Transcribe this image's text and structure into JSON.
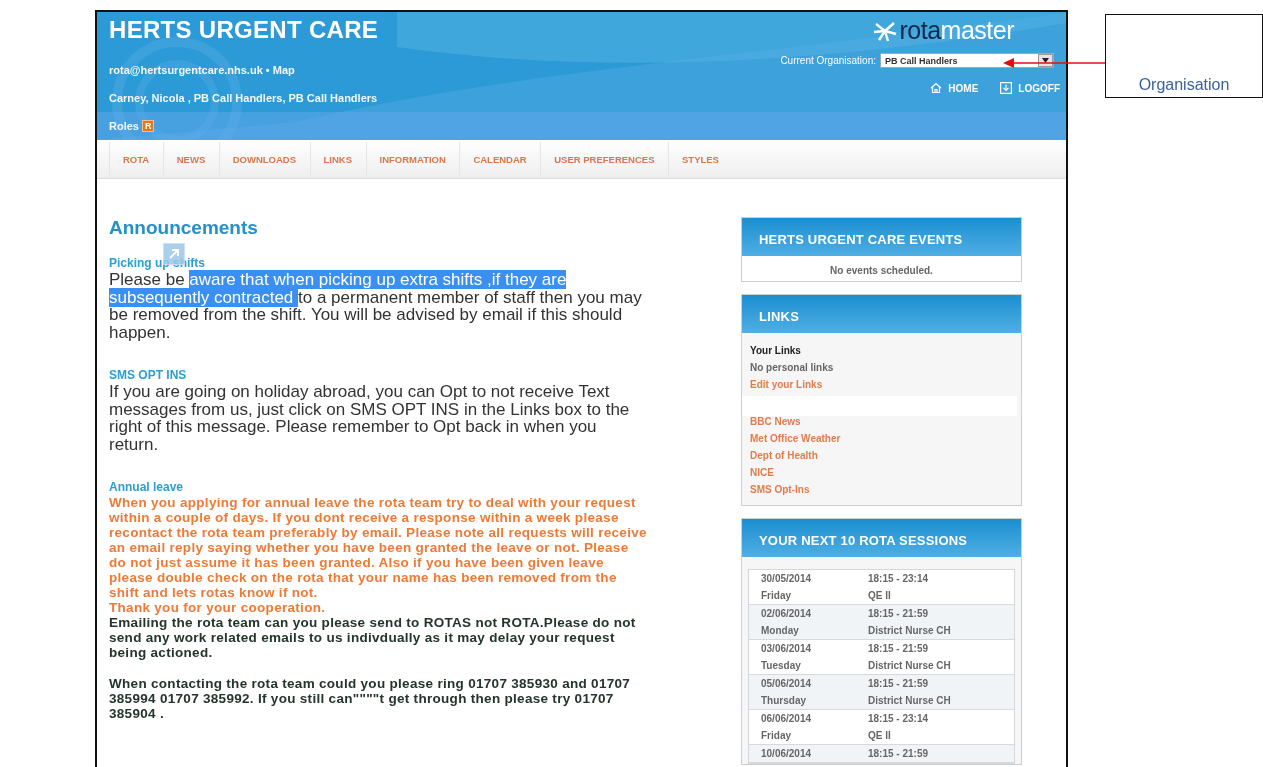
{
  "header": {
    "title": "HERTS URGENT CARE",
    "contact_line": "rota@hertsurgentcare.nhs.uk • Map",
    "user_line": "Carney, Nicola , PB Call Handlers, PB Call Handlers",
    "roles_label": "Roles",
    "roles_badge": "R",
    "logo": [
      {
        "text": "rota",
        "kind": "dark"
      },
      {
        "text": "master",
        "kind": "light"
      }
    ],
    "organisation_label": "Current Organisation:",
    "organisation_value": "PB Call Handlers",
    "actions": [
      {
        "label": "HOME",
        "kind": "home"
      },
      {
        "label": "LOGOFF",
        "kind": "logoff"
      }
    ]
  },
  "nav": [
    "ROTA",
    "NEWS",
    "DOWNLOADS",
    "LINKS",
    "INFORMATION",
    "CALENDAR",
    "USER PREFERENCES",
    "STYLES"
  ],
  "announcements": {
    "title": "Announcements",
    "items": [
      {
        "heading": "Picking up shifts",
        "covered": true,
        "paragraphs": [
          {
            "kind": "plain",
            "segments": [
              {
                "text": "Please be ",
                "highlighted": false
              },
              {
                "text": "aware that when picking up extra shifts ,if they are subsequently contracted ",
                "highlighted": true
              },
              {
                "text": "to a permanent member of staff then you may  be removed  from the shift. You will be advised by email if this should happen.",
                "highlighted": false
              }
            ]
          }
        ]
      },
      {
        "heading": "SMS OPT INS",
        "covered": false,
        "paragraphs": [
          {
            "kind": "plain",
            "segments": [
              {
                "text": "If you are going on holiday abroad, you can Opt to not receive Text messages from us, just click on  SMS OPT INS in the Links box to the right of this message. Please remember to Opt back in when you return.",
                "highlighted": false
              }
            ]
          }
        ]
      },
      {
        "heading": "Annual leave",
        "covered": false,
        "paragraphs": [
          {
            "kind": "orange",
            "segments": [
              {
                "text": "When you  applying for annual leave the rota team try to deal with your request within a couple of days. If you dont receive a response within a week please recontact the rota team preferably by email. Please note all requests will receive an email reply saying whether you have been granted the leave or not.  Please do not just assume it has been granted. Also if you have been given leave please double check on the rota that your name has been removed from the shift and lets rotas know  if not.",
                "highlighted": false
              }
            ]
          },
          {
            "kind": "orange",
            "segments": [
              {
                "text": "Thank you for your cooperation.",
                "highlighted": false
              }
            ]
          },
          {
            "kind": "dark",
            "segments": [
              {
                "text": "Emailing the rota team can you please send to ROTAS not ROTA.Please do not send any work related emails to us indivdually as it may delay your request being actioned.",
                "highlighted": false
              }
            ]
          },
          {
            "kind": "dark-spaced",
            "segments": [
              {
                "text": "When contacting the rota team could you please ring 01707 385930 and 01707  385994 01707 385992. If you still can\"\"\"\"t get through then please try 01707 385904 .",
                "highlighted": false
              }
            ]
          }
        ]
      }
    ]
  },
  "events": {
    "title": "HERTS URGENT CARE EVENTS",
    "message": "No events scheduled."
  },
  "links": {
    "title": "LINKS",
    "items": [
      {
        "text": "Your Links",
        "kind": "heading"
      },
      {
        "text": "No personal links",
        "kind": "note"
      },
      {
        "text": "Edit your Links",
        "kind": "link"
      },
      {
        "kind": "gap"
      },
      {
        "text": "BBC News",
        "kind": "link"
      },
      {
        "text": "Met Office Weather",
        "kind": "link"
      },
      {
        "text": "Dept of Health",
        "kind": "link"
      },
      {
        "text": "NICE",
        "kind": "link"
      },
      {
        "text": "SMS Opt-Ins",
        "kind": "link"
      }
    ]
  },
  "sessions": {
    "title": "YOUR NEXT 10 ROTA SESSIONS",
    "rows": [
      {
        "date": "30/05/2014",
        "time": "18:15 - 23:14",
        "day": "Friday",
        "place": "QE II"
      },
      {
        "date": "02/06/2014",
        "time": "18:15 - 21:59",
        "day": "Monday",
        "place": "District Nurse CH"
      },
      {
        "date": "03/06/2014",
        "time": "18:15 - 21:59",
        "day": "Tuesday",
        "place": "District Nurse CH"
      },
      {
        "date": "05/06/2014",
        "time": "18:15 - 21:59",
        "day": "Thursday",
        "place": "District Nurse CH"
      },
      {
        "date": "06/06/2014",
        "time": "18:15 - 23:14",
        "day": "Friday",
        "place": "QE II"
      },
      {
        "date": "10/06/2014",
        "time": "18:15 - 21:59"
      }
    ]
  },
  "callout": {
    "label": "Organisation"
  }
}
